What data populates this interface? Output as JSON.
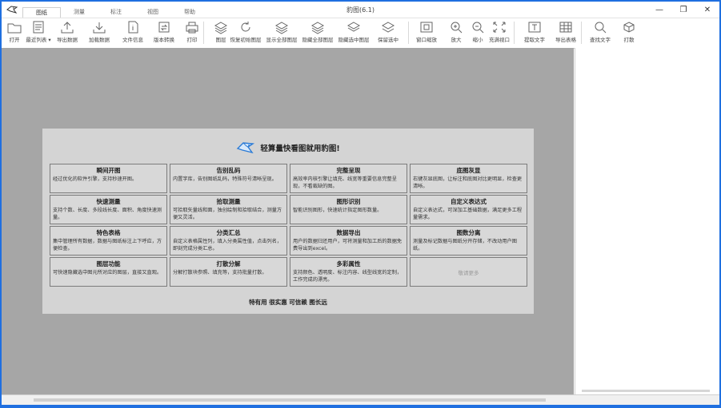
{
  "window": {
    "title": "豹图(6.1)"
  },
  "menu_tabs": [
    "图纸",
    "测量",
    "标注",
    "视图",
    "帮助"
  ],
  "window_controls": {
    "minimize": "—",
    "maximize": "❐",
    "close": "✕"
  },
  "toolbar": [
    {
      "label": "打开",
      "icon": "folder-icon"
    },
    {
      "label": "最近列表 ▾",
      "icon": "recent-list-icon"
    },
    {
      "label": "导出数据",
      "icon": "export-data-icon"
    },
    {
      "label": "加载数据",
      "icon": "load-data-icon"
    },
    {
      "label": "文件信息",
      "icon": "file-info-icon"
    },
    {
      "label": "版本转换",
      "icon": "version-convert-icon"
    },
    {
      "label": "打印",
      "icon": "printer-icon"
    },
    {
      "label": "图层",
      "icon": "layers-icon"
    },
    {
      "label": "恢复初始图层",
      "icon": "restore-layers-icon"
    },
    {
      "label": "显示全部图层",
      "icon": "show-all-layers-icon"
    },
    {
      "label": "隐藏全部图层",
      "icon": "hide-all-layers-icon"
    },
    {
      "label": "隐藏选中图层",
      "icon": "hide-selected-layer-icon"
    },
    {
      "label": "保留选中",
      "icon": "keep-selected-icon"
    },
    {
      "label": "窗口缩放",
      "icon": "window-zoom-icon"
    },
    {
      "label": "放大",
      "icon": "zoom-in-icon"
    },
    {
      "label": "缩小",
      "icon": "zoom-out-icon"
    },
    {
      "label": "充满视口",
      "icon": "fit-viewport-icon"
    },
    {
      "label": "提取文字",
      "icon": "extract-text-icon"
    },
    {
      "label": "导出表格",
      "icon": "export-table-icon"
    },
    {
      "label": "查找文字",
      "icon": "find-text-icon"
    },
    {
      "label": "打散",
      "icon": "explode-icon"
    }
  ],
  "welcome": {
    "title": "轻算量快看图就用豹图!",
    "features": [
      {
        "title": "瞬间开图",
        "desc": "经过优化的软件引擎，支持秒速开图。"
      },
      {
        "title": "告别乱码",
        "desc": "内置字库，告别图纸乱码，特殊符号清晰呈现。"
      },
      {
        "title": "完整呈现",
        "desc": "高效率内核引擎让填充、线宽等重要信息完整呈现，不看裁缺的图。"
      },
      {
        "title": "底图灰显",
        "desc": "右键灰显底图，让标注和底图对比更明显，检查更清晰。"
      },
      {
        "title": "快速测量",
        "desc": "支持个数、长度、多段线长度、面积、角度快速测量。"
      },
      {
        "title": "拾取测量",
        "desc": "可拾取矢量线和面，独创绘制和拾取结合，测量方便又灵活。"
      },
      {
        "title": "图形识别",
        "desc": "智能识别图形，快速统计指定图形数量。"
      },
      {
        "title": "自定义表达式",
        "desc": "自定义表达式，可深加工基础数据，满足更多工程量需求。"
      },
      {
        "title": "特色表格",
        "desc": "集中管理所有数据，数据与图纸标注上下呼应，方便检查。"
      },
      {
        "title": "分类汇总",
        "desc": "自定义表格属性列，填入分类属性值，点击列名，即刻完成分类汇总。"
      },
      {
        "title": "数据导出",
        "desc": "用户的数据归还用户，可将测量和加工后的数据免费导出到excel。"
      },
      {
        "title": "图数分离",
        "desc": "测量及标记数据与图纸分开存储，不改动用户图纸。"
      },
      {
        "title": "图层功能",
        "desc": "可快速隐藏选中图元所对应的图层，直接又直观。"
      },
      {
        "title": "打散分解",
        "desc": "分解打散块参照、填充等，支持批量打散。"
      },
      {
        "title": "多彩属性",
        "desc": "支持颜色、透明度、标注内容、线型线宽的定制，工作完成的漂亮。"
      }
    ],
    "more_label": "敬请更多",
    "slogan": "特有用 很实惠 可信赖 图长远"
  }
}
